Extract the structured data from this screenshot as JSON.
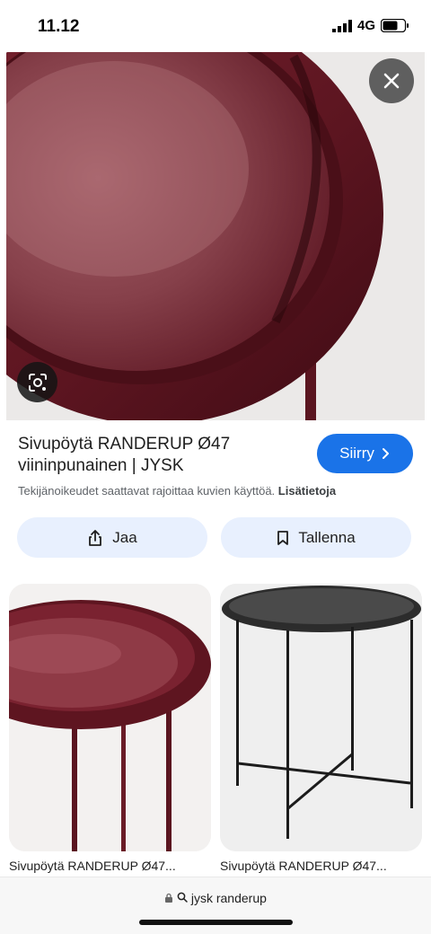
{
  "status": {
    "time": "11.12",
    "network": "4G"
  },
  "hero": {
    "icons": {
      "close": "close-icon",
      "lens": "lens-icon"
    }
  },
  "result": {
    "title_line1": "Sivupöytä RANDERUP Ø47",
    "title_line2": "viininpunainen | JYSK",
    "go_button": "Siirry",
    "copyright_text": "Tekijänoikeudet saattavat rajoittaa kuvien käyttöä.",
    "copyright_link": "Lisätietoja"
  },
  "actions": {
    "share": "Jaa",
    "save": "Tallenna"
  },
  "related": [
    {
      "title": "Sivupöytä RANDERUP Ø47..."
    },
    {
      "title": "Sivupöytä RANDERUP Ø47..."
    }
  ],
  "browser": {
    "url": "jysk randerup"
  },
  "colors": {
    "accent": "#1a73e8",
    "product": "#6e1a24",
    "chip": "#e8f0fe"
  }
}
